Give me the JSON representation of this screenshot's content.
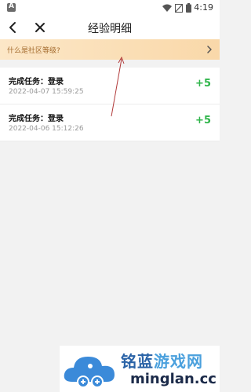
{
  "status_bar": {
    "time": "4:19"
  },
  "nav": {
    "title": "经验明细"
  },
  "banner": {
    "text": "什么是社区等级?"
  },
  "items": [
    {
      "task": "完成任务：登录",
      "time": "2022-04-07 15:59:25",
      "points": "+5"
    },
    {
      "task": "完成任务：登录",
      "time": "2022-04-06 15:12:26",
      "points": "+5"
    }
  ],
  "watermark": {
    "brand": "铭蓝",
    "brand_suffix": "游戏网",
    "domain": "minglan.cc"
  },
  "colors": {
    "accent_green": "#2fb54a",
    "banner_text": "#a36a2c",
    "annotation_arrow": "#b13a3a"
  }
}
